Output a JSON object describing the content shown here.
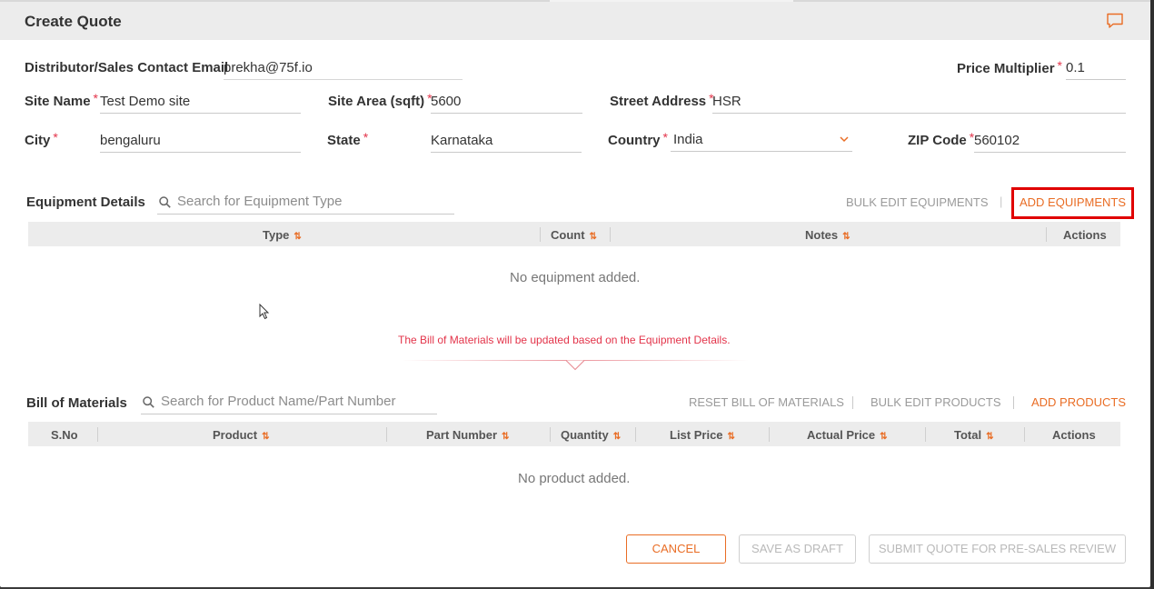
{
  "dialog": {
    "title": "Create Quote"
  },
  "form": {
    "distributor_email": {
      "label": "Distributor/Sales Contact Email",
      "value": "prekha@75f.io"
    },
    "price_multiplier": {
      "label": "Price Multiplier",
      "required": "*",
      "value": "0.1"
    },
    "site_name": {
      "label": "Site Name",
      "required": "*",
      "value": "Test Demo site"
    },
    "site_area": {
      "label": "Site Area (sqft)",
      "required": "*",
      "value": "5600"
    },
    "street_address": {
      "label": "Street Address",
      "required": "*",
      "value": "HSR"
    },
    "city": {
      "label": "City",
      "required": "*",
      "value": "bengaluru"
    },
    "state": {
      "label": "State",
      "required": "*",
      "value": "Karnataka"
    },
    "country": {
      "label": "Country",
      "required": "*",
      "value": "India"
    },
    "zip": {
      "label": "ZIP Code",
      "required": "*",
      "value": "560102"
    }
  },
  "equipment": {
    "title": "Equipment Details",
    "search_placeholder": "Search for Equipment Type",
    "bulk_edit": "BULK EDIT EQUIPMENTS",
    "separator": "|",
    "add": "ADD EQUIPMENTS",
    "columns": [
      "Type",
      "Count",
      "Notes",
      "Actions"
    ],
    "empty": "No equipment added."
  },
  "notice": "The Bill of Materials will be updated based on the Equipment Details.",
  "bom": {
    "title": "Bill of Materials",
    "search_placeholder": "Search for Product Name/Part Number",
    "reset": "RESET BILL OF MATERIALS",
    "bulk_edit": "BULK EDIT PRODUCTS",
    "add": "ADD PRODUCTS",
    "columns": [
      "S.No",
      "Product",
      "Part Number",
      "Quantity",
      "List Price",
      "Actual Price",
      "Total",
      "Actions"
    ],
    "empty": "No product added."
  },
  "footer": {
    "cancel": "CANCEL",
    "save_draft": "SAVE AS DRAFT",
    "submit": "SUBMIT QUOTE FOR PRE-SALES REVIEW"
  },
  "icons": {
    "sort": "⇅"
  },
  "colors": {
    "accent": "#e96d25",
    "required": "#e3344a",
    "highlight": "#e00000"
  }
}
